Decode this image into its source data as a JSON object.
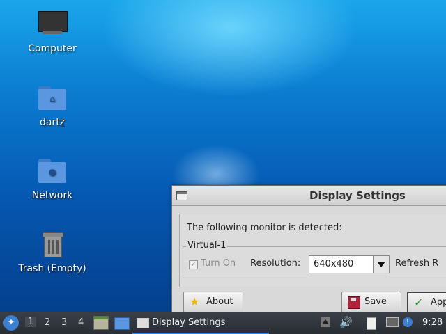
{
  "desktop": {
    "icons": [
      {
        "label": "Computer",
        "icon": "monitor-icon"
      },
      {
        "label": "dartz",
        "icon": "home-folder-icon"
      },
      {
        "label": "Network",
        "icon": "network-folder-icon"
      },
      {
        "label": "Trash (Empty)",
        "icon": "trash-icon"
      }
    ]
  },
  "dialog": {
    "title": "Display Settings",
    "detected_text": "The following monitor is detected:",
    "monitor_name": "Virtual-1",
    "turn_on_label": "Turn On",
    "turn_on_checked": true,
    "resolution_label": "Resolution:",
    "resolution_value": "640x480",
    "refresh_label": "Refresh R",
    "buttons": {
      "about": "About",
      "save": "Save",
      "apply": "App"
    }
  },
  "taskbar": {
    "workspaces": [
      "1",
      "2",
      "3",
      "4"
    ],
    "active_workspace": "1",
    "task_label": "Display Settings",
    "clock": "9:28"
  },
  "colors": {
    "accent": "#3b7fd0",
    "taskbar_bg": "#2e3440"
  }
}
